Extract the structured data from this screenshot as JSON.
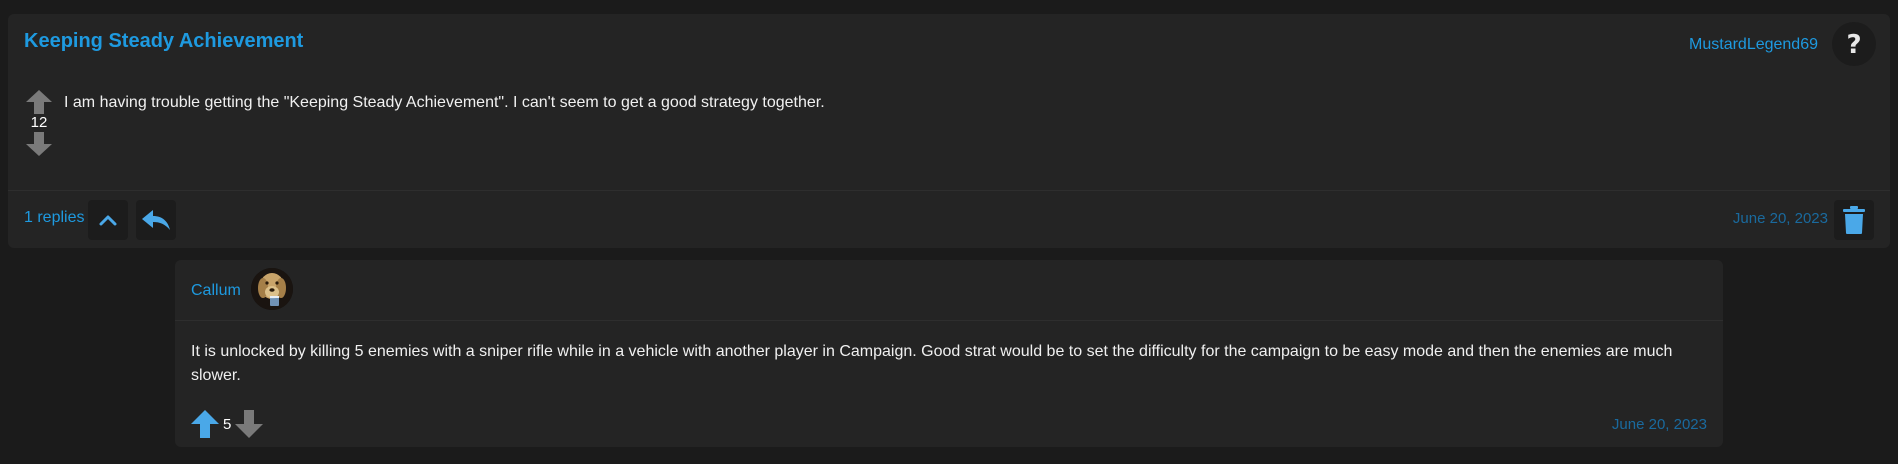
{
  "post": {
    "title": "Keeping Steady Achievement",
    "author": "MustardLegend69",
    "avatar_icon": "question-mark-icon",
    "votes": "12",
    "body": "I am having trouble getting the \"Keeping Steady Achievement\". I can't seem to get a good strategy together.",
    "replies_label": "1 replies",
    "date": "June 20, 2023"
  },
  "reply": {
    "author": "Callum",
    "body": "It is unlocked by killing 5 enemies with a sniper rifle while in a vehicle with another player in Campaign. Good strat would be to set the difficulty for the campaign to be easy mode and then the enemies are much slower.",
    "votes": "5",
    "date": "June 20, 2023"
  },
  "colors": {
    "accent": "#1e9ae0",
    "date": "#1a6a9e",
    "icon_blue": "#4aa8e8",
    "vote_grey": "#7a7a7a",
    "panel": "#242424",
    "background": "#1b1b1b"
  }
}
